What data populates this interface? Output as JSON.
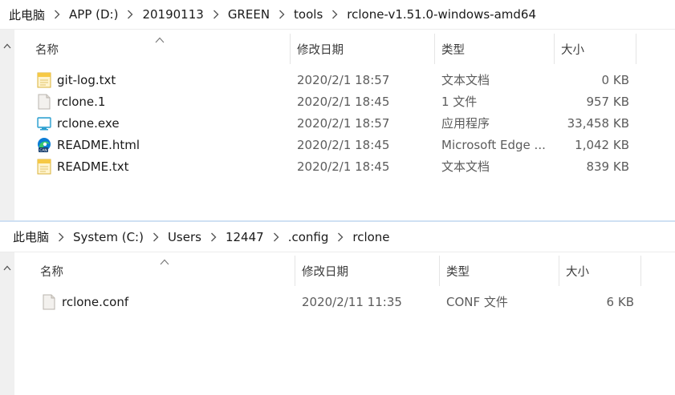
{
  "top_pane": {
    "breadcrumb": [
      "此电脑",
      "APP (D:)",
      "20190113",
      "GREEN",
      "tools",
      "rclone-v1.51.0-windows-amd64"
    ],
    "columns": {
      "name": "名称",
      "date": "修改日期",
      "type": "类型",
      "size": "大小"
    },
    "files": [
      {
        "name": "git-log.txt",
        "date": "2020/2/1 18:57",
        "type": "文本文档",
        "size": "0 KB",
        "icon": "text-file-icon"
      },
      {
        "name": "rclone.1",
        "date": "2020/2/1 18:45",
        "type": "1 文件",
        "size": "957 KB",
        "icon": "blank-file-icon"
      },
      {
        "name": "rclone.exe",
        "date": "2020/2/1 18:57",
        "type": "应用程序",
        "size": "33,458 KB",
        "icon": "application-icon"
      },
      {
        "name": "README.html",
        "date": "2020/2/1 18:45",
        "type": "Microsoft Edge ...",
        "size": "1,042 KB",
        "icon": "edge-html-icon"
      },
      {
        "name": "README.txt",
        "date": "2020/2/1 18:45",
        "type": "文本文档",
        "size": "839 KB",
        "icon": "text-file-icon"
      }
    ]
  },
  "bottom_pane": {
    "breadcrumb": [
      "此电脑",
      "System (C:)",
      "Users",
      "12447",
      ".config",
      "rclone"
    ],
    "columns": {
      "name": "名称",
      "date": "修改日期",
      "type": "类型",
      "size": "大小"
    },
    "files": [
      {
        "name": "rclone.conf",
        "date": "2020/2/11 11:35",
        "type": "CONF 文件",
        "size": "6 KB",
        "icon": "blank-file-icon"
      }
    ]
  },
  "colors": {
    "divider": "#cfe0f3",
    "text": "#1a1a1a",
    "secondary_text": "#5c5c5c",
    "edge_blue": "#0c7dd6",
    "edge_green": "#38c76a",
    "notepad_yellow": "#f6c945"
  }
}
